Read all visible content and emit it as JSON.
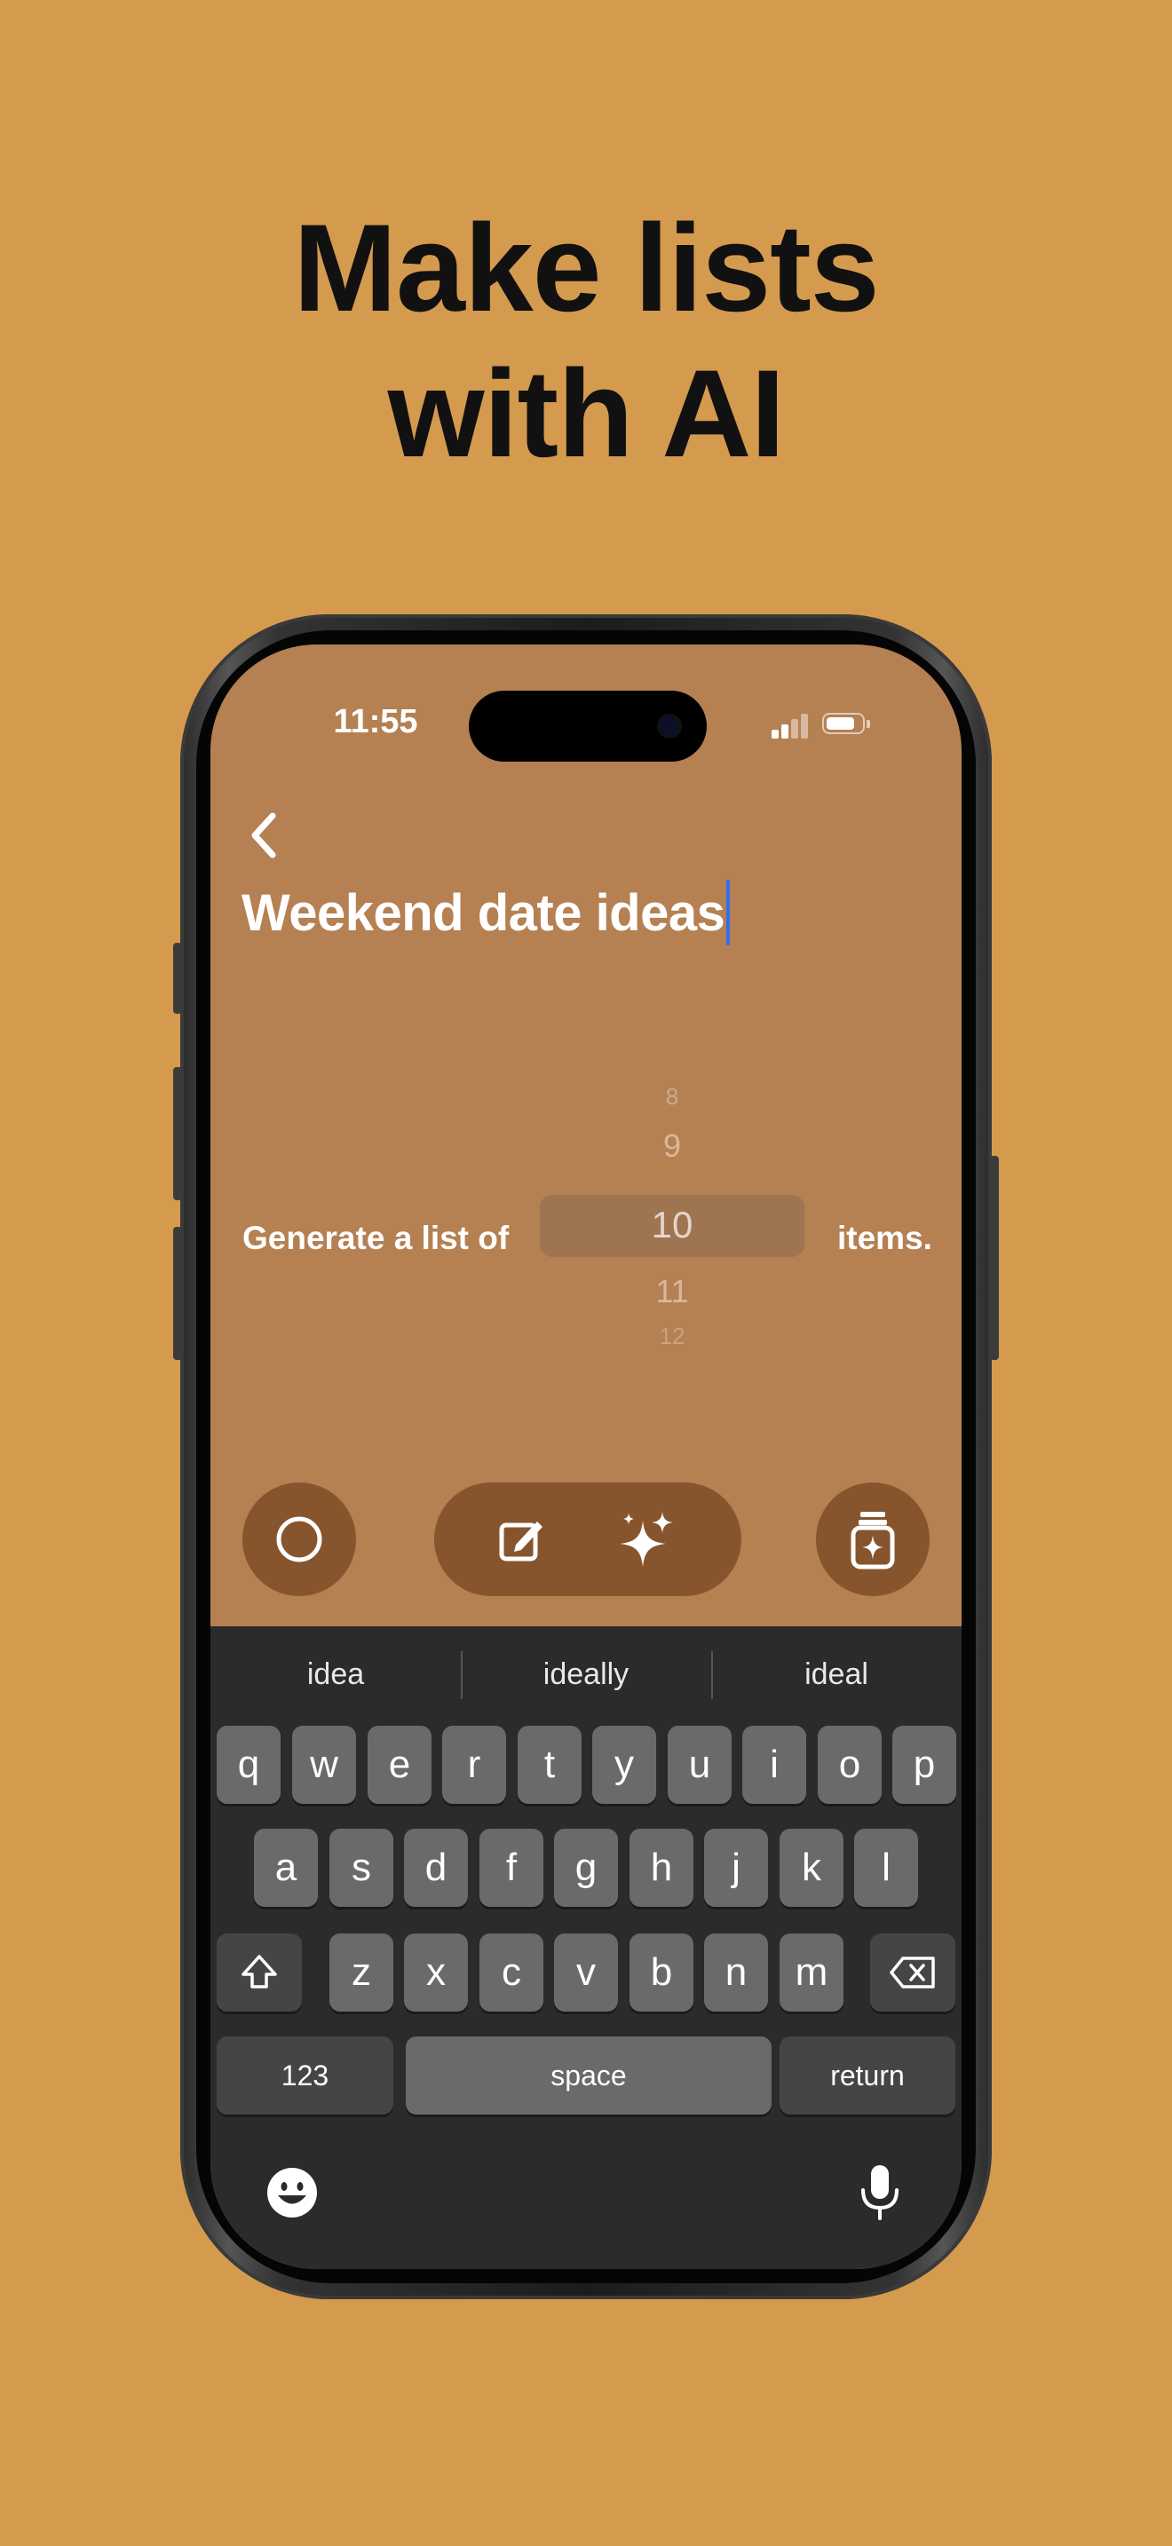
{
  "headline": {
    "line1": "Make lists",
    "line2": "with AI"
  },
  "status_bar": {
    "time": "11:55"
  },
  "editor": {
    "title": "Weekend date ideas",
    "generate_prefix": "Generate a list of",
    "generate_suffix": "items.",
    "picker": {
      "options": [
        "8",
        "9",
        "10",
        "11",
        "12"
      ],
      "selected": "10"
    }
  },
  "toolbar": {
    "left": "circle-icon",
    "pill": [
      "edit-icon",
      "sparkles-icon"
    ],
    "right": "jar-sparkle-icon"
  },
  "keyboard": {
    "suggestions": [
      "idea",
      "ideally",
      "ideal"
    ],
    "row1": [
      "q",
      "w",
      "e",
      "r",
      "t",
      "y",
      "u",
      "i",
      "o",
      "p"
    ],
    "row2": [
      "a",
      "s",
      "d",
      "f",
      "g",
      "h",
      "j",
      "k",
      "l"
    ],
    "row3": [
      "z",
      "x",
      "c",
      "v",
      "b",
      "n",
      "m"
    ],
    "numbers_label": "123",
    "space_label": "space",
    "return_label": "return"
  },
  "colors": {
    "background": "#D49A4E",
    "screen": "#B58052",
    "control": "#87552D",
    "caret": "#2F6DF0",
    "keyboard": "#2B2B2B"
  }
}
